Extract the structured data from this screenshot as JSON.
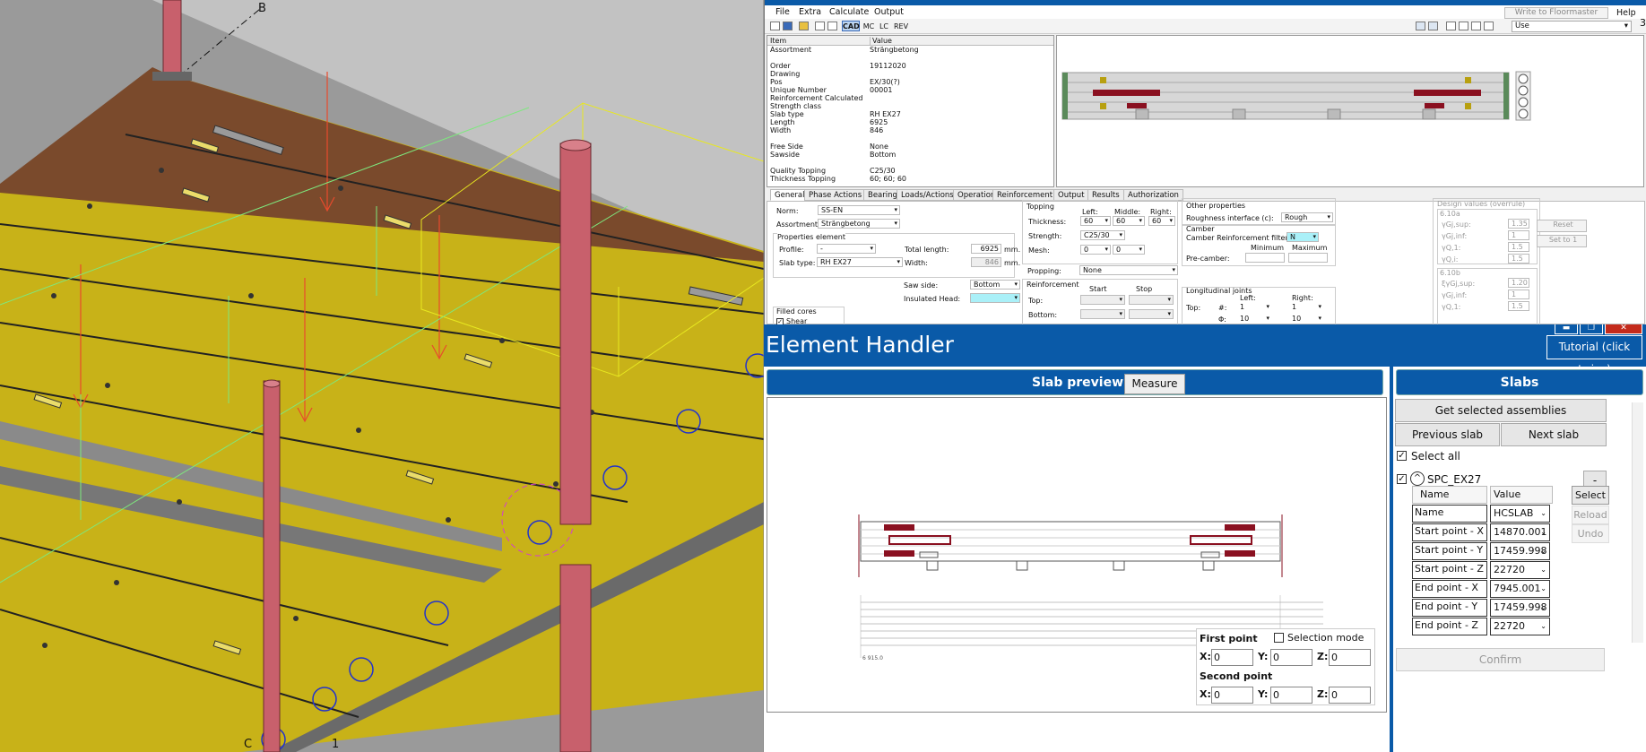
{
  "cad": {
    "label_b": "B",
    "label_c": "C",
    "label_1": "1"
  },
  "menu": {
    "file": "File",
    "extra": "Extra",
    "calculate": "Calculate",
    "output": "Output",
    "help": "Help",
    "write_button": "Write to Floormaster",
    "corner_number": "3"
  },
  "toolbar": {
    "cad": "CAD",
    "mc": "MC",
    "lc": "LC",
    "rev": "REV",
    "use": "Use"
  },
  "props": {
    "col_item": "Item",
    "col_value": "Value",
    "rows": [
      {
        "k": "Assortment",
        "v": "Strängbetong"
      },
      {
        "k": "",
        "v": ""
      },
      {
        "k": "Order",
        "v": "19112020"
      },
      {
        "k": "Drawing",
        "v": ""
      },
      {
        "k": "Pos",
        "v": "EX/30(?)"
      },
      {
        "k": "Unique Number",
        "v": "00001"
      },
      {
        "k": "Reinforcement Calculated",
        "v": ""
      },
      {
        "k": "Strength class",
        "v": ""
      },
      {
        "k": "Slab type",
        "v": "RH EX27"
      },
      {
        "k": "Length",
        "v": "6925"
      },
      {
        "k": "Width",
        "v": "846"
      },
      {
        "k": "",
        "v": ""
      },
      {
        "k": "Free Side",
        "v": "None"
      },
      {
        "k": "Sawside",
        "v": "Bottom"
      },
      {
        "k": "",
        "v": ""
      },
      {
        "k": "Quality Topping",
        "v": "C25/30"
      },
      {
        "k": "Thickness Topping",
        "v": "60; 60; 60"
      }
    ]
  },
  "tabs": [
    "General",
    "Phase Actions",
    "Bearings",
    "Loads/Actions",
    "Operations",
    "Reinforcement",
    "Output",
    "Results",
    "Authorization"
  ],
  "form": {
    "norm_l": "Norm:",
    "norm_v": "SS-EN",
    "assort_l": "Assortment:",
    "assort_v": "Strängbetong",
    "props_el": "Properties element",
    "profile_l": "Profile:",
    "profile_v": "-",
    "slabtype_l": "Slab type:",
    "slabtype_v": "RH EX27",
    "total_l": "Total length:",
    "total_v": "6925",
    "mm1": "mm.",
    "width_l": "Width:",
    "width_v": "846",
    "mm2": "mm.",
    "saw_l": "Saw side:",
    "saw_v": "Bottom",
    "ins_l": "Insulated Head:",
    "filled": "Filled cores",
    "shear": "Shear",
    "topping": "Topping",
    "left": "Left:",
    "middle": "Middle:",
    "right": "Right:",
    "thick_l": "Thickness:",
    "t_left": "60",
    "t_mid": "60",
    "t_right": "60",
    "strength_l": "Strength:",
    "strength_v": "C25/30",
    "mesh_l": "Mesh:",
    "mesh_a": "0",
    "mesh_b": "0",
    "propping_l": "Propping:",
    "propping_v": "None",
    "reinf": "Reinforcement",
    "start": "Start",
    "stop": "Stop",
    "top_l": "Top:",
    "bottom_l": "Bottom:",
    "other": "Other properties",
    "rough_l": "Roughness interface (c):",
    "rough_v": "Rough",
    "camber": "Camber",
    "camber_filter_l": "Camber Reinforcement filter:",
    "camber_filter_v": "N",
    "minimum": "Minimum",
    "maximum": "Maximum",
    "precamber_l": "Pre-camber:",
    "longj": "Longitudinal joints",
    "lj_left": "Left:",
    "lj_right": "Right:",
    "lj_top": "Top:",
    "hash": "#:",
    "phi": "Φ:",
    "lj_a": "1",
    "lj_b": "1",
    "lj_c": "10",
    "lj_d": "10",
    "design": "Design values (overrule)",
    "g610a": "6.10a",
    "g610b": "6.10b",
    "ygjsup": "γGj,sup:",
    "ygjinf": "γGj,inf:",
    "yq1": "γQ,1:",
    "yqi": "γQ,i:",
    "eygjsup": "ξγGj,sup:",
    "v1": "1.35",
    "v2": "1",
    "v3": "1.5",
    "v4": "1.5",
    "v5": "1.20",
    "v6": "1",
    "v7": "1.5",
    "reset": "Reset",
    "setto1": "Set to 1"
  },
  "handler": {
    "title": "Element Handler",
    "tutorial": "Tutorial (click twice)",
    "slab_preview": "Slab preview",
    "measure": "Measure",
    "first_point": "First point",
    "second_point": "Second point",
    "selection_mode": "Selection mode",
    "x": "X:",
    "y": "Y:",
    "z": "Z:",
    "p1x": "0",
    "p1y": "0",
    "p1z": "0",
    "p2x": "0",
    "p2y": "0",
    "p2z": "0",
    "drawing_total": "6 915.0",
    "slabs": "Slabs",
    "get_selected": "Get selected assemblies",
    "previous": "Previous slab",
    "next": "Next slab",
    "select_all": "Select all",
    "group": "SPC_EX27",
    "minus": "-",
    "col_name": "Name",
    "col_value": "Value",
    "select": "Select",
    "reload": "Reload",
    "undo": "Undo",
    "rows": [
      {
        "name": "Name",
        "value": "HCSLAB"
      },
      {
        "name": "Start point - X",
        "value": "14870.001"
      },
      {
        "name": "Start point - Y",
        "value": "17459.998"
      },
      {
        "name": "Start point - Z",
        "value": "22720"
      },
      {
        "name": "End point - X",
        "value": "7945.001"
      },
      {
        "name": "End point - Y",
        "value": "17459.998"
      },
      {
        "name": "End point - Z",
        "value": "22720"
      }
    ],
    "confirm": "Confirm"
  },
  "colors": {
    "accent": "#0a5aa8",
    "slab": "#c8b218",
    "column": "#c8606c",
    "beam": "#7a4a2c",
    "load": "#e84a2c"
  }
}
